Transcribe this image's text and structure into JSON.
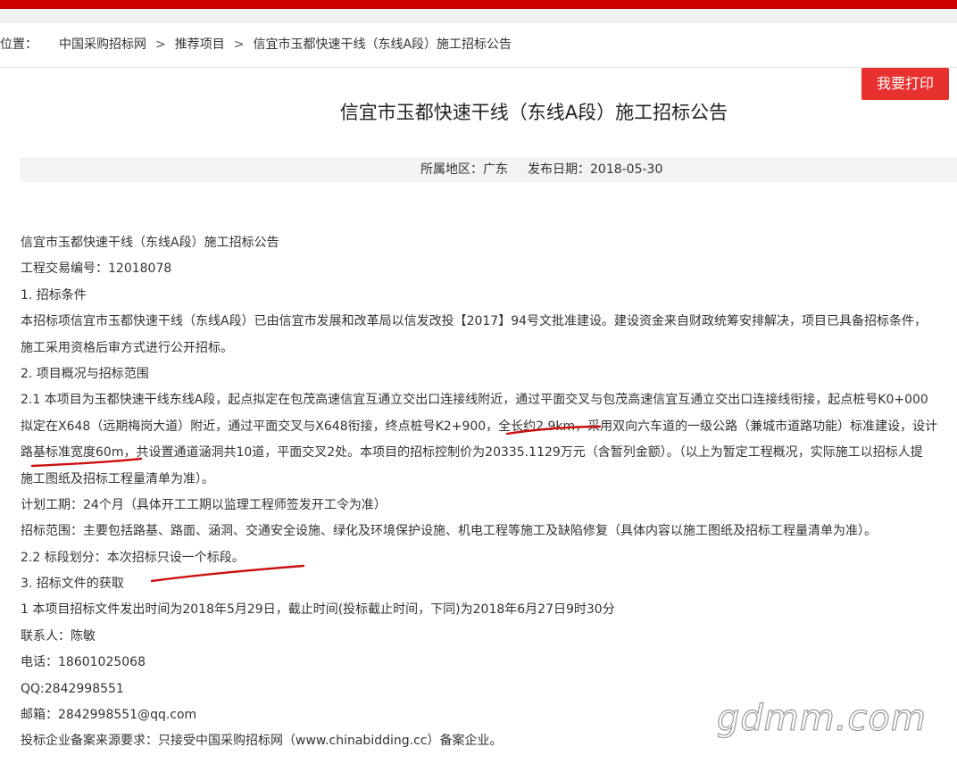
{
  "breadcrumb": {
    "prefix": "位置：",
    "items": [
      "中国采购招标网",
      "推荐项目",
      "信宜市玉都快速干线（东线A段）施工招标公告"
    ],
    "separator": ">"
  },
  "print_button": "我要打印",
  "article": {
    "title": "信宜市玉都快速干线（东线A段）施工招标公告",
    "region": "所属地区：广东",
    "publish_date": "发布日期：2018-05-30",
    "lines": [
      "信宜市玉都快速干线（东线A段）施工招标公告",
      "工程交易编号：12018078",
      "1. 招标条件",
      "本招标项信宜市玉都快速干线（东线A段）已由信宜市发展和改革局以信发改投【2017】94号文批准建设。建设资金来自财政统筹安排解决，项目已具备招标条件，",
      "施工采用资格后审方式进行公开招标。",
      "2. 项目概况与招标范围",
      "2.1 本项目为玉都快速干线东线A段，起点拟定在包茂高速信宜互通立交出口连接线附近，通过平面交叉与包茂高速信宜互通立交出口连接线衔接，起点桩号K0+000",
      "拟定在X648（远期梅岗大道）附近，通过平面交叉与X648衔接，终点桩号K2+900，全长约2.9km，采用双向六车道的一级公路（兼城市道路功能）标准建设，设计",
      "路基标准宽度60m，共设置通道涵洞共10道，平面交叉2处。本项目的招标控制价为20335.1129万元（含暂列金额）。（以上为暂定工程概况，实际施工以招标人提",
      "施工图纸及招标工程量清单为准）。",
      "计划工期：24个月（具体开工工期以监理工程师签发开工令为准）",
      "招标范围：主要包括路基、路面、涵洞、交通安全设施、绿化及环境保护设施、机电工程等施工及缺陷修复（具体内容以施工图纸及招标工程量清单为准）。",
      "2.2 标段划分：本次招标只设一个标段。",
      "3. 招标文件的获取",
      "1 本项目招标文件发出时间为2018年5月29日，截止时间(投标截止时间，下同)为2018年6月27日9时30分",
      "联系人：陈敏",
      "电话：18601025068",
      "QQ:2842998551",
      "邮箱：2842998551@qq.com",
      "投标企业备案来源要求：只接受中国采购招标网（www.chinabidding.cc）备案企业。"
    ]
  },
  "watermark": "gdmm.com",
  "colors": {
    "brand_red": "#cc0000",
    "button_red": "#e8312f",
    "annotation_red": "#cc1010"
  }
}
